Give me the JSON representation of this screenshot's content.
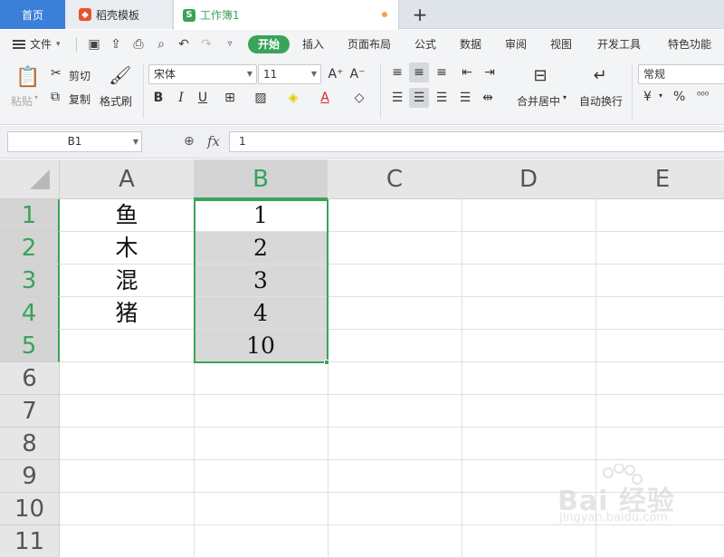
{
  "tabs": {
    "home": "首页",
    "template": "稻壳模板",
    "workbook": "工作簿1",
    "workbook_icon": "S",
    "add": "+"
  },
  "menu": {
    "file": "文件",
    "items": [
      "开始",
      "插入",
      "页面布局",
      "公式",
      "数据",
      "审阅",
      "视图",
      "开发工具",
      "特色功能"
    ]
  },
  "ribbon": {
    "paste": "粘贴",
    "cut": "剪切",
    "copy": "复制",
    "format_painter": "格式刷",
    "font_name": "宋体",
    "font_size": "11",
    "merge_center": "合并居中",
    "wrap_text": "自动换行",
    "number_format": "常规",
    "currency_symbol": "¥",
    "percent_symbol": "%"
  },
  "formula_bar": {
    "name_box": "B1",
    "fx": "fx",
    "value": "1"
  },
  "sheet": {
    "columns": [
      "A",
      "B",
      "C",
      "D",
      "E"
    ],
    "rows": [
      "1",
      "2",
      "3",
      "4",
      "5",
      "6",
      "7",
      "8",
      "9",
      "10",
      "11"
    ],
    "colA": [
      "鱼",
      "木",
      "混",
      "猪"
    ],
    "colB": [
      "1",
      "2",
      "3",
      "4",
      "10"
    ]
  },
  "watermark": {
    "brand": "Bai 经验",
    "url": "jingyan.baidu.com"
  },
  "colors": {
    "accent": "#3aa35a",
    "home_tab": "#3c7fd9"
  }
}
